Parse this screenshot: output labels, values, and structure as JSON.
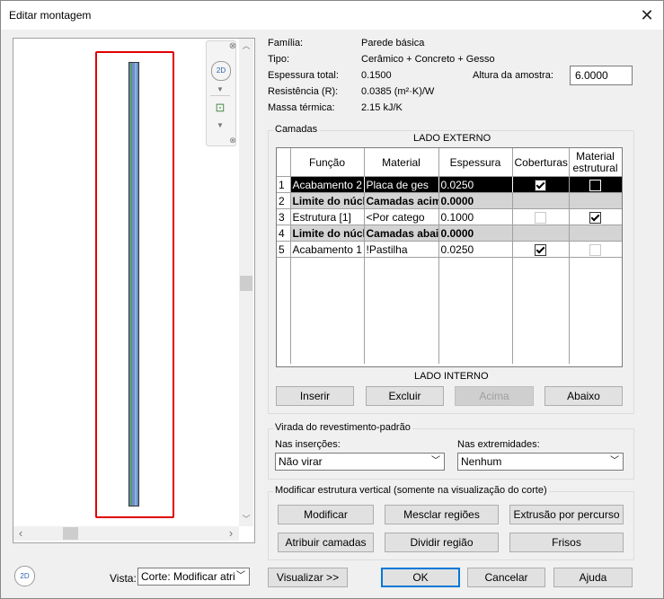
{
  "window": {
    "title": "Editar montagem"
  },
  "props": {
    "familia": {
      "label": "Família:",
      "value": "Parede básica"
    },
    "tipo": {
      "label": "Tipo:",
      "value": "Cerâmico + Concreto + Gesso"
    },
    "espessura": {
      "label": "Espessura total:",
      "value": "0.1500"
    },
    "resistencia": {
      "label": "Resistência (R):",
      "value": "0.0385 (m²·K)/W"
    },
    "massa": {
      "label": "Massa térmica:",
      "value": "2.15 kJ/K"
    },
    "altura": {
      "label": "Altura da amostra:",
      "value": "6.0000"
    }
  },
  "layers": {
    "group_label": "Camadas",
    "top_side": "LADO EXTERNO",
    "bottom_side": "LADO INTERNO",
    "headers": [
      "Função",
      "Material",
      "Espessura",
      "Coberturas",
      "Material estrutural"
    ],
    "rows": [
      {
        "n": "1",
        "funcao": "Acabamento 2",
        "material": "Placa de ges",
        "espessura": "0.0250",
        "coberturas": "checked",
        "estrutural": "filled",
        "style": "selected"
      },
      {
        "n": "2",
        "funcao": "Limite do núcl",
        "material": "Camadas acim",
        "espessura": "0.0000",
        "coberturas": "",
        "estrutural": "",
        "style": "core"
      },
      {
        "n": "3",
        "funcao": "Estrutura [1]",
        "material": "<Por catego",
        "espessura": "0.1000",
        "coberturas": "disabled",
        "estrutural": "checked",
        "style": "normal"
      },
      {
        "n": "4",
        "funcao": "Limite do núcl",
        "material": "Camadas abaix",
        "espessura": "0.0000",
        "coberturas": "",
        "estrutural": "",
        "style": "core"
      },
      {
        "n": "5",
        "funcao": "Acabamento 1",
        "material": "!Pastilha",
        "espessura": "0.0250",
        "coberturas": "checked",
        "estrutural": "disabled",
        "style": "normal"
      }
    ],
    "buttons": {
      "inserir": "Inserir",
      "excluir": "Excluir",
      "acima": "Acima",
      "abaixo": "Abaixo"
    }
  },
  "wrap": {
    "group_label": "Virada do revestimento-padrão",
    "insercoes_label": "Nas inserções:",
    "insercoes_value": "Não virar",
    "extremidades_label": "Nas extremidades:",
    "extremidades_value": "Nenhum"
  },
  "vertical": {
    "group_label": "Modificar estrutura vertical (somente na visualização do corte)",
    "buttons": {
      "modificar": "Modificar",
      "mesclar": "Mesclar regiões",
      "extrusao": "Extrusão por percurso",
      "atribuir": "Atribuir camadas",
      "dividir": "Dividir região",
      "frisos": "Frisos"
    }
  },
  "bottom": {
    "vista_label": "Vista:",
    "vista_value": "Corte: Modificar atrit",
    "visualizar": "Visualizar >>",
    "ok": "OK",
    "cancelar": "Cancelar",
    "ajuda": "Ajuda"
  },
  "colors": {
    "selection": "#000000",
    "core_row": "#d4d4d4",
    "accent": "#0078d7",
    "highlight_frame": "#e00000",
    "wall_fill": "#6d8fc9"
  },
  "icons": {
    "close": "close-icon",
    "zoom2d": "zoom-2d-icon",
    "zoom_region": "zoom-region-icon",
    "scroll_up": "chevron-up-icon",
    "scroll_down": "chevron-down-icon",
    "scroll_left": "chevron-left-icon",
    "scroll_right": "chevron-right-icon"
  }
}
